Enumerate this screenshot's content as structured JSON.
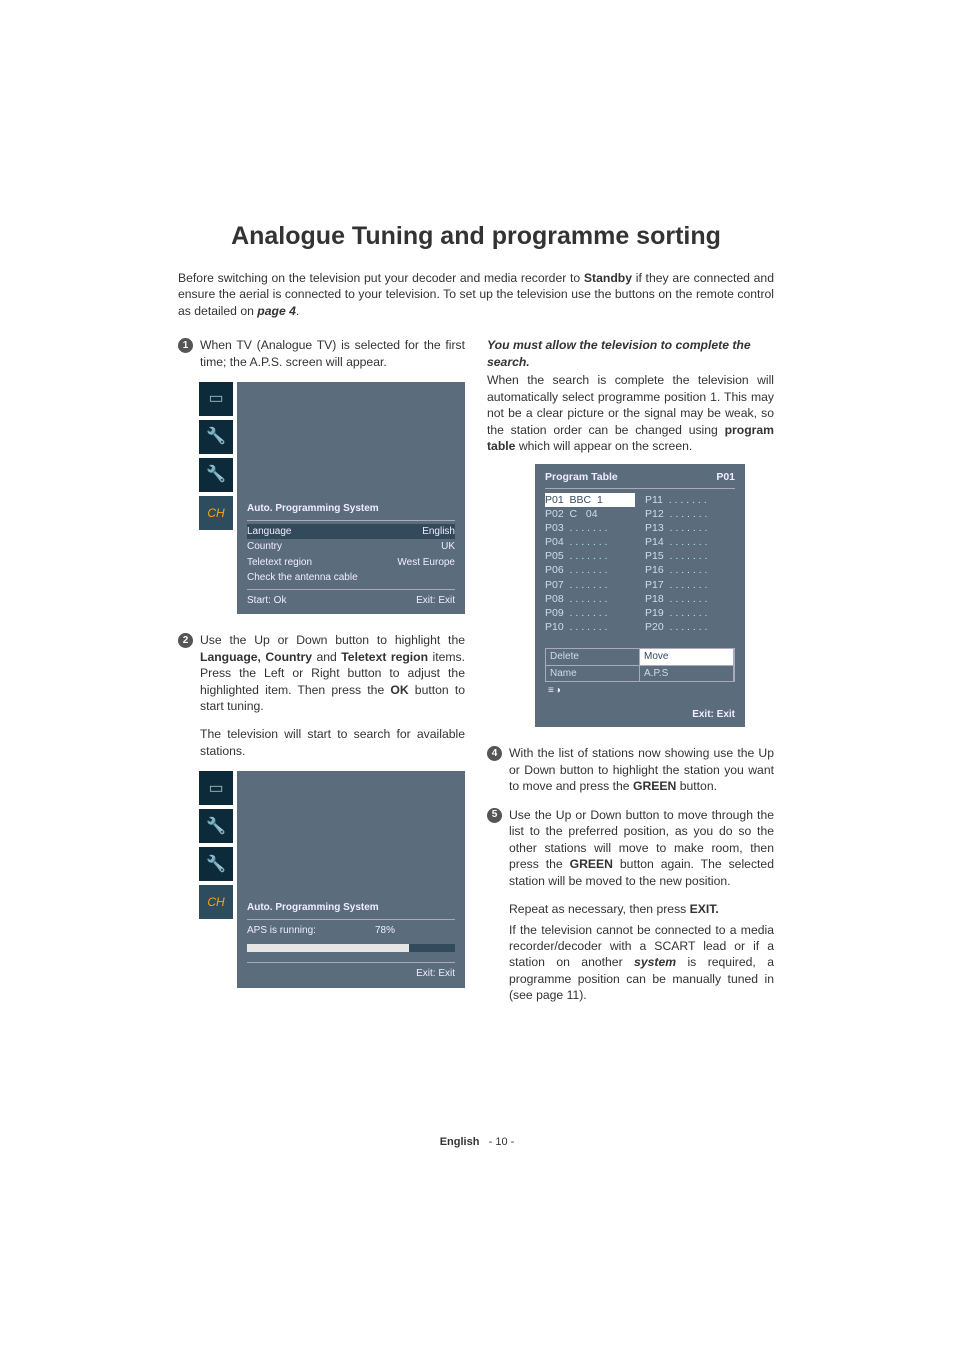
{
  "title": "Analogue Tuning and programme sorting",
  "intro": "Before switching on the television put your decoder and media recorder to <strong>Standby</strong> if they are connected and ensure the aerial is connected to your television. To set up the television use the buttons on the remote control as detailed on <em><strong>page 4</strong></em>.",
  "step1_num": "1",
  "step1": "When TV (Analogue TV) is selected for the first time; the A.P.S. screen will appear.",
  "step2_num": "2",
  "step2": "Use the Up or Down button to highlight the <strong>Language, Country</strong> and <strong>Teletext region</strong> items. Press the Left or Right button to adjust the highlighted item. Then press the <strong>OK</strong> button to start tuning.",
  "step3": "The television will start to search for available stations.",
  "right_lead": "You must allow the television to complete the search.",
  "right_para": "When the search is complete the television will automatically select programme position 1. This may not be a clear picture or the signal may be weak, so the station order can be changed using <strong>program table</strong> which will appear on the screen.",
  "step4_num": "4",
  "step4": "With the list of stations now showing use the Up or Down button to highlight the station you want to move and press the <strong>GREEN</strong> button.",
  "step5_num": "5",
  "step5": "Use the Up or Down button to move through the list to the preferred position, as you do so the other stations will move to make room, then press the <strong>GREEN</strong> button again. The selected station will be moved to the new position.",
  "repeat": "Repeat as necessary, then press <strong>EXIT.</strong>",
  "tail": "If the television cannot be connected to a media recorder/decoder with a SCART lead or if a station on another <em><strong>system</strong></em> is required, a programme position can be manually tuned in (see page 11).",
  "osd1": {
    "title": "Auto. Programming System",
    "rows": [
      {
        "l": "Language",
        "r": "English"
      },
      {
        "l": "Country",
        "r": "UK"
      },
      {
        "l": "Teletext region",
        "r": "West Europe"
      }
    ],
    "check": "Check the antenna cable",
    "start": "Start: Ok",
    "exit": "Exit: Exit"
  },
  "osd2": {
    "title": "Auto. Programming System",
    "running": "APS is running:",
    "pct": "78%",
    "exit": "Exit: Exit"
  },
  "ptable": {
    "name": "Program Table",
    "pos": "P01",
    "left": [
      {
        "p": "P01",
        "t": "BBC  1",
        "sel": true
      },
      {
        "p": "P02",
        "t": "C   04"
      },
      {
        "p": "P03",
        "t": ". . . . . . ."
      },
      {
        "p": "P04",
        "t": ". . . . . . ."
      },
      {
        "p": "P05",
        "t": ". . . . . . ."
      },
      {
        "p": "P06",
        "t": ". . . . . . ."
      },
      {
        "p": "P07",
        "t": ". . . . . . ."
      },
      {
        "p": "P08",
        "t": ". . . . . . ."
      },
      {
        "p": "P09",
        "t": ". . . . . . ."
      },
      {
        "p": "P10",
        "t": ". . . . . . ."
      }
    ],
    "right": [
      {
        "p": "P11",
        "t": ". . . . . . ."
      },
      {
        "p": "P12",
        "t": ". . . . . . ."
      },
      {
        "p": "P13",
        "t": ". . . . . . ."
      },
      {
        "p": "P14",
        "t": ". . . . . . ."
      },
      {
        "p": "P15",
        "t": ". . . . . . ."
      },
      {
        "p": "P16",
        "t": ". . . . . . ."
      },
      {
        "p": "P17",
        "t": ". . . . . . ."
      },
      {
        "p": "P18",
        "t": ". . . . . . ."
      },
      {
        "p": "P19",
        "t": ". . . . . . ."
      },
      {
        "p": "P20",
        "t": ". . . . . . ."
      }
    ],
    "btns": {
      "tl": "Delete",
      "tr": "Move",
      "bl": "Name",
      "br": "A.P.S"
    },
    "exit": "Exit: Exit"
  },
  "footer_lang": "English",
  "footer_page": "- 10 -"
}
